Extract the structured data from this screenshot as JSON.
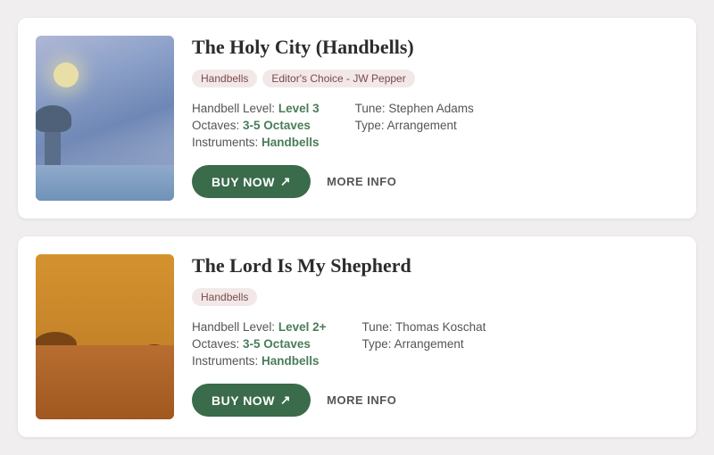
{
  "cards": [
    {
      "id": "holy-city",
      "title": "The Holy City (Handbells)",
      "tags": [
        {
          "label": "Handbells",
          "style": "default"
        },
        {
          "label": "Editor's Choice - JW Pepper",
          "style": "editor"
        }
      ],
      "details_left": [
        {
          "label": "Handbell Level:",
          "value": "Level 3",
          "colored": true
        },
        {
          "label": "Octaves:",
          "value": "3-5 Octaves",
          "colored": true
        },
        {
          "label": "Instruments:",
          "value": "Handbells",
          "colored": true
        }
      ],
      "details_right": [
        {
          "label": "Tune:",
          "value": "Stephen Adams",
          "colored": false
        },
        {
          "label": "Type:",
          "value": "Arrangement",
          "colored": false
        }
      ],
      "buy_label": "BUY NOW",
      "more_label": "MORE INFO",
      "thumb": "1"
    },
    {
      "id": "lord-shepherd",
      "title": "The Lord Is My Shepherd",
      "tags": [
        {
          "label": "Handbells",
          "style": "default"
        }
      ],
      "details_left": [
        {
          "label": "Handbell Level:",
          "value": "Level 2+",
          "colored": true
        },
        {
          "label": "Octaves:",
          "value": "3-5 Octaves",
          "colored": true
        },
        {
          "label": "Instruments:",
          "value": "Handbells",
          "colored": true
        }
      ],
      "details_right": [
        {
          "label": "Tune:",
          "value": "Thomas Koschat",
          "colored": false
        },
        {
          "label": "Type:",
          "value": "Arrangement",
          "colored": false
        }
      ],
      "buy_label": "BUY NOW",
      "more_label": "MORE INFO",
      "thumb": "2"
    }
  ]
}
